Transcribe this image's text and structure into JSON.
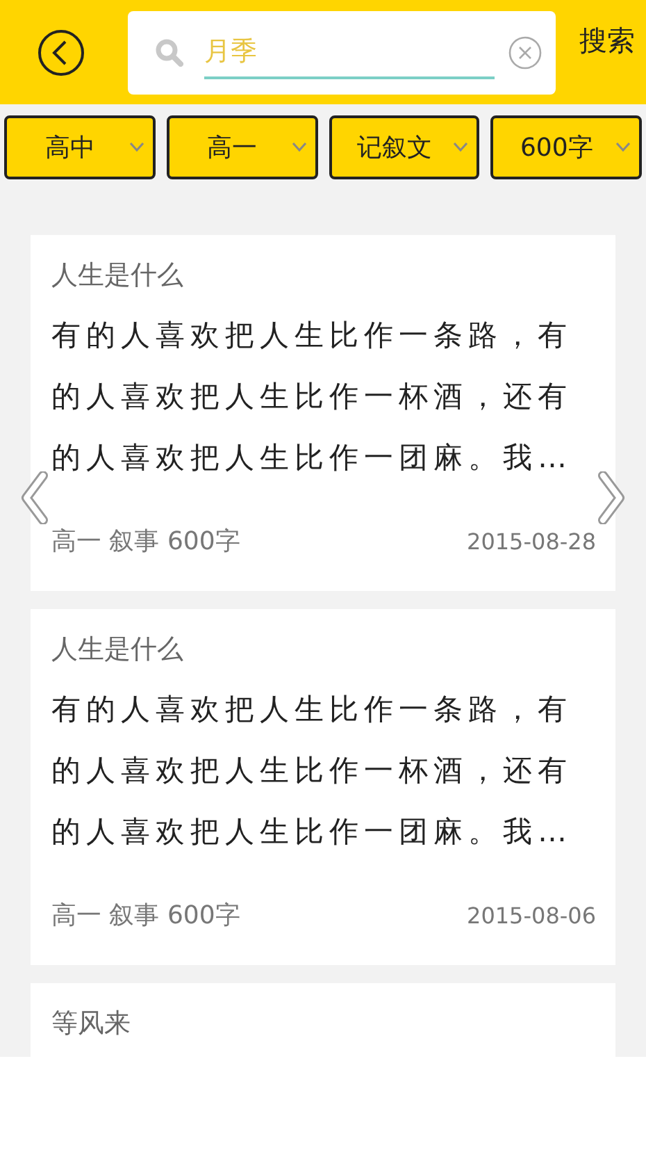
{
  "header": {
    "search": {
      "value": "月季"
    },
    "search_button": "搜索"
  },
  "filters": [
    {
      "label": "高中"
    },
    {
      "label": "高一"
    },
    {
      "label": "记叙文"
    },
    {
      "label": "600字"
    }
  ],
  "articles": [
    {
      "title": "人生是什么",
      "excerpt": "有的人喜欢把人生比作一条路，有的人喜欢把人生比作一杯酒，还有的人喜欢把人生比作一团麻。我…",
      "meta": "高一 叙事 600字",
      "date": "2015-08-28"
    },
    {
      "title": "人生是什么",
      "excerpt": "有的人喜欢把人生比作一条路，有的人喜欢把人生比作一杯酒，还有的人喜欢把人生比作一团麻。我…",
      "meta": "高一 叙事 600字",
      "date": "2015-08-06"
    },
    {
      "title": "等风来"
    }
  ]
}
